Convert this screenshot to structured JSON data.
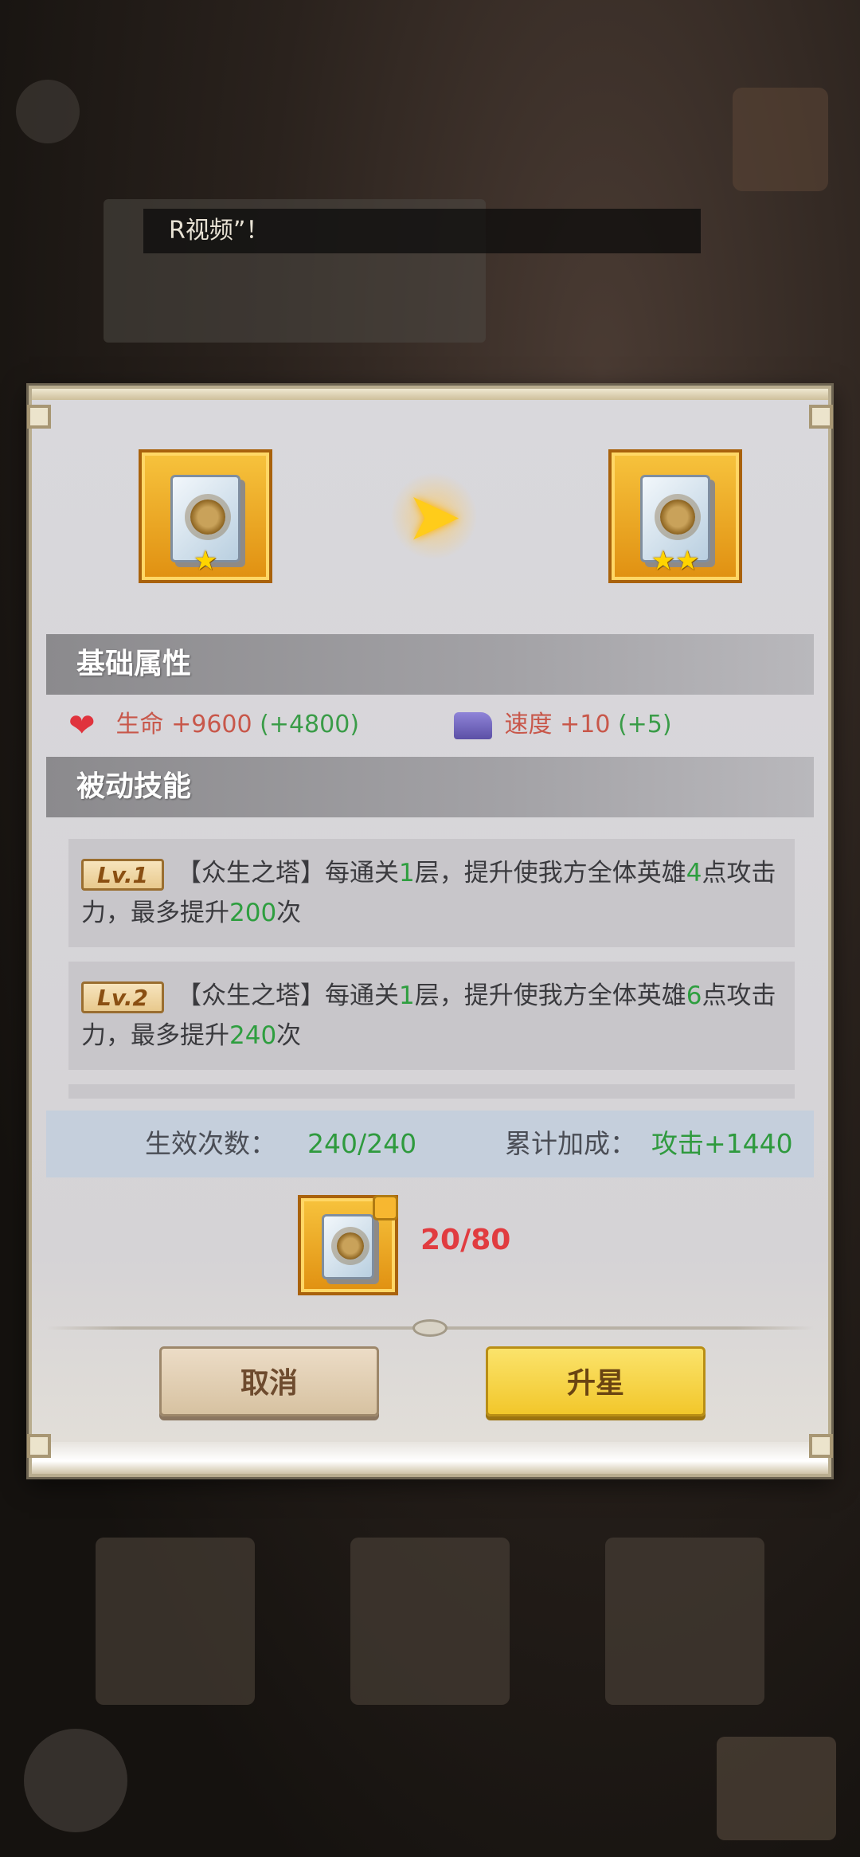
{
  "toast": {
    "text": "R视频”！"
  },
  "upgrade": {
    "from_stars": "★",
    "to_stars": "★★",
    "arrow": "➤"
  },
  "basic": {
    "title": "基础属性",
    "hp": {
      "label": "生命",
      "value": "+9600",
      "bonus": "(+4800)"
    },
    "speed": {
      "label": "速度",
      "value": "+10",
      "bonus": "(+5)"
    }
  },
  "passive": {
    "title": "被动技能",
    "skills": [
      {
        "level": "Lv.1",
        "name": "【众生之塔】",
        "p1": "每通关",
        "n1": "1",
        "p2": "层，提升使我方全体英雄",
        "n2": "4",
        "p3": "点攻击力，最多提升",
        "n3": "200",
        "p4": "次"
      },
      {
        "level": "Lv.2",
        "name": "【众生之塔】",
        "p1": "每通关",
        "n1": "1",
        "p2": "层，提升使我方全体英雄",
        "n2": "6",
        "p3": "点攻击力，最多提升",
        "n3": "240",
        "p4": "次"
      }
    ]
  },
  "summary": {
    "count_label": "生效次数：",
    "count_value": "240/240",
    "total_label": "累计加成：",
    "total_value": "攻击+1440"
  },
  "cost": {
    "text": "20/80"
  },
  "buttons": {
    "cancel": "取消",
    "upgrade": "升星"
  },
  "colors": {
    "accent": "#f2c72b",
    "bonus_green": "#2e9e3f",
    "stat_red": "#c8574a"
  },
  "icons": [
    "heart-icon",
    "speed-boot-icon",
    "scroll-item-icon",
    "arrow-right-icon",
    "puzzle-piece-icon"
  ]
}
